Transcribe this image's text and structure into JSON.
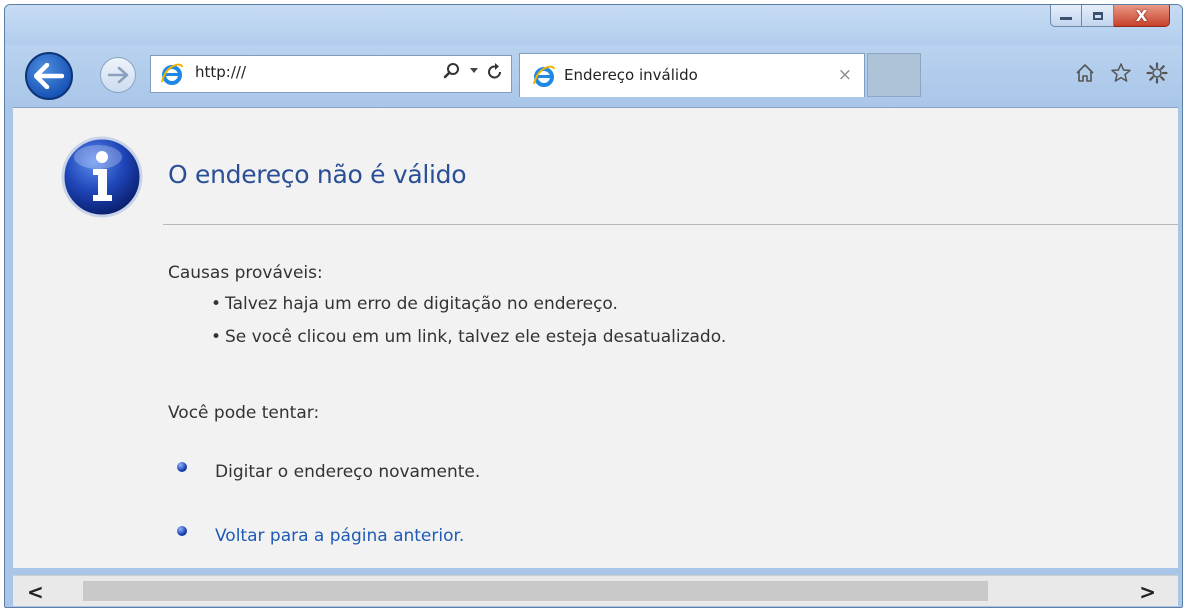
{
  "browser": {
    "address_bar": {
      "url": "http:///"
    },
    "tab": {
      "title": "Endereço inválido",
      "close_glyph": "×"
    },
    "caption_buttons": {
      "close_glyph": "X"
    },
    "icons": [
      "back-icon",
      "forward-icon",
      "ie-logo-icon",
      "search-icon",
      "dropdown-icon",
      "refresh-icon",
      "home-icon",
      "favorites-star-icon",
      "tools-gear-icon"
    ]
  },
  "page": {
    "heading": "O endereço não é válido",
    "causes_label": "Causas prováveis:",
    "causes": [
      "Talvez haja um erro de digitação no endereço.",
      "Se você clicou em um link, talvez ele esteja desatualizado."
    ],
    "bullet_char": "•",
    "try_label": "Você pode tentar:",
    "suggestions": {
      "retype": "Digitar o endereço novamente.",
      "go_back": "Voltar para a página anterior."
    }
  },
  "scrollbar": {
    "left_arrow": "<",
    "right_arrow": ">"
  },
  "colors": {
    "frame": "#a9c6e9",
    "heading": "#2a4f96",
    "link": "#1f5bb5",
    "content_bg": "#f2f2f2"
  }
}
